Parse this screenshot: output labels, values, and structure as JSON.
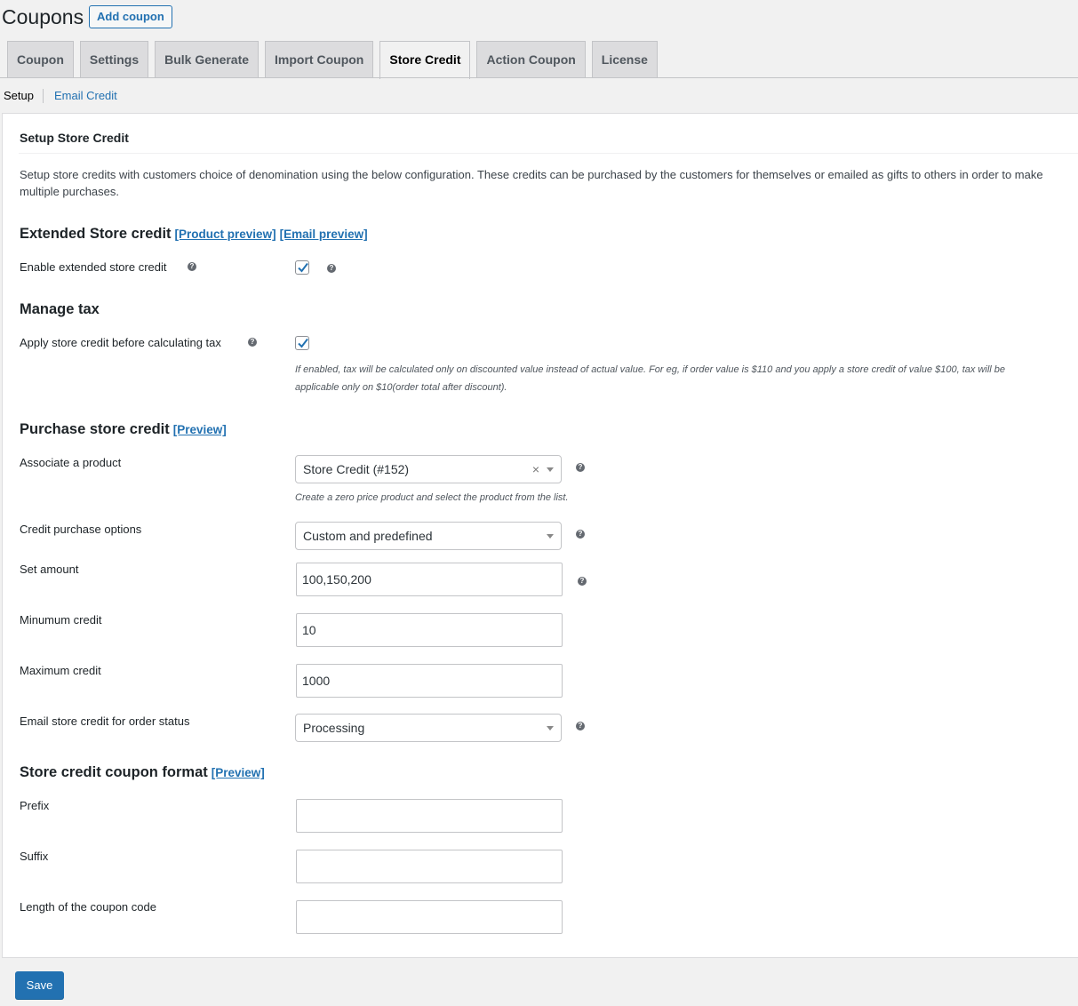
{
  "header": {
    "title": "Coupons",
    "add_button": "Add coupon"
  },
  "tabs": [
    {
      "label": "Coupon"
    },
    {
      "label": "Settings"
    },
    {
      "label": "Bulk Generate"
    },
    {
      "label": "Import Coupon"
    },
    {
      "label": "Store Credit",
      "active": true
    },
    {
      "label": "Action Coupon"
    },
    {
      "label": "License"
    }
  ],
  "subnav": {
    "current": "Setup",
    "link": "Email Credit"
  },
  "setup": {
    "title": "Setup Store Credit",
    "intro": "Setup store credits with customers choice of denomination using the below configuration. These credits can be purchased by the customers for themselves or emailed as gifts to others in order to make multiple purchases."
  },
  "extended": {
    "heading": "Extended Store credit",
    "product_preview": "[Product preview]",
    "email_preview": "[Email preview]",
    "enable_label": "Enable extended store credit",
    "enable_checked": true
  },
  "tax": {
    "heading": "Manage tax",
    "apply_label": "Apply store credit before calculating tax",
    "apply_checked": true,
    "desc_line1": "If enabled, tax will be calculated only on discounted value instead of actual value. For eg, if order value is $110 and you apply a store credit of value $100, tax will be",
    "desc_line2": "applicable only on $10(order total after discount)."
  },
  "purchase": {
    "heading": "Purchase store credit",
    "preview": "[Preview]",
    "associate_label": "Associate a product",
    "associate_value": "Store Credit (#152)",
    "associate_clear": "×",
    "associate_desc": "Create a zero price product and select the product from the list.",
    "options_label": "Credit purchase options",
    "options_value": "Custom and predefined",
    "amount_label": "Set amount",
    "amount_value": "100,150,200",
    "min_label": "Minumum credit",
    "min_value": "10",
    "max_label": "Maximum credit",
    "max_value": "1000",
    "status_label": "Email store credit for order status",
    "status_value": "Processing"
  },
  "format": {
    "heading": "Store credit coupon format",
    "preview": "[Preview]",
    "prefix_label": "Prefix",
    "prefix_value": "",
    "suffix_label": "Suffix",
    "suffix_value": "",
    "length_label": "Length of the coupon code",
    "length_value": ""
  },
  "footer": {
    "save_label": "Save"
  },
  "help_glyph": "?",
  "colors": {
    "accent": "#2271b1",
    "background": "#f1f1f1",
    "panel": "#ffffff"
  }
}
